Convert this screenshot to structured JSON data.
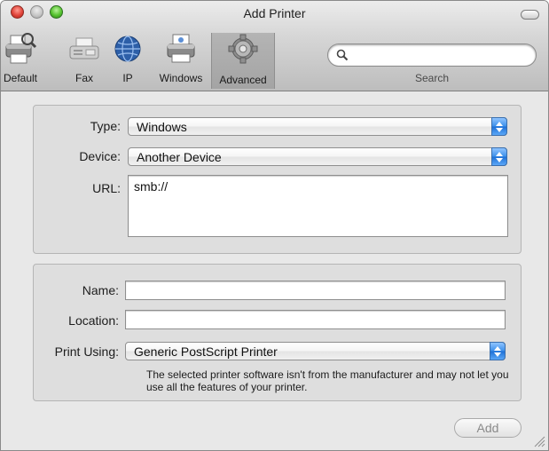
{
  "window": {
    "title": "Add Printer"
  },
  "toolbar": {
    "items": [
      {
        "label": "Default",
        "icon": "default-printer-icon"
      },
      {
        "label": "Fax",
        "icon": "fax-icon"
      },
      {
        "label": "IP",
        "icon": "globe-icon"
      },
      {
        "label": "Windows",
        "icon": "windows-printer-icon"
      },
      {
        "label": "Advanced",
        "icon": "gear-icon",
        "selected": true
      }
    ],
    "search": {
      "label": "Search",
      "value": "",
      "icon": "magnifier-icon"
    }
  },
  "connection": {
    "type_label": "Type:",
    "type_value": "Windows",
    "device_label": "Device:",
    "device_value": "Another Device",
    "url_label": "URL:",
    "url_value": "smb://"
  },
  "printer": {
    "name_label": "Name:",
    "name_value": "",
    "location_label": "Location:",
    "location_value": "",
    "print_using_label": "Print Using:",
    "print_using_value": "Generic PostScript Printer",
    "note": "The selected printer software isn't from the manufacturer and may not let you use all the features of your printer."
  },
  "actions": {
    "add_label": "Add",
    "add_enabled": false
  },
  "colors": {
    "accent_blue": "#3b8fea",
    "close_red": "#e0443a",
    "zoom_green": "#55c22e"
  }
}
